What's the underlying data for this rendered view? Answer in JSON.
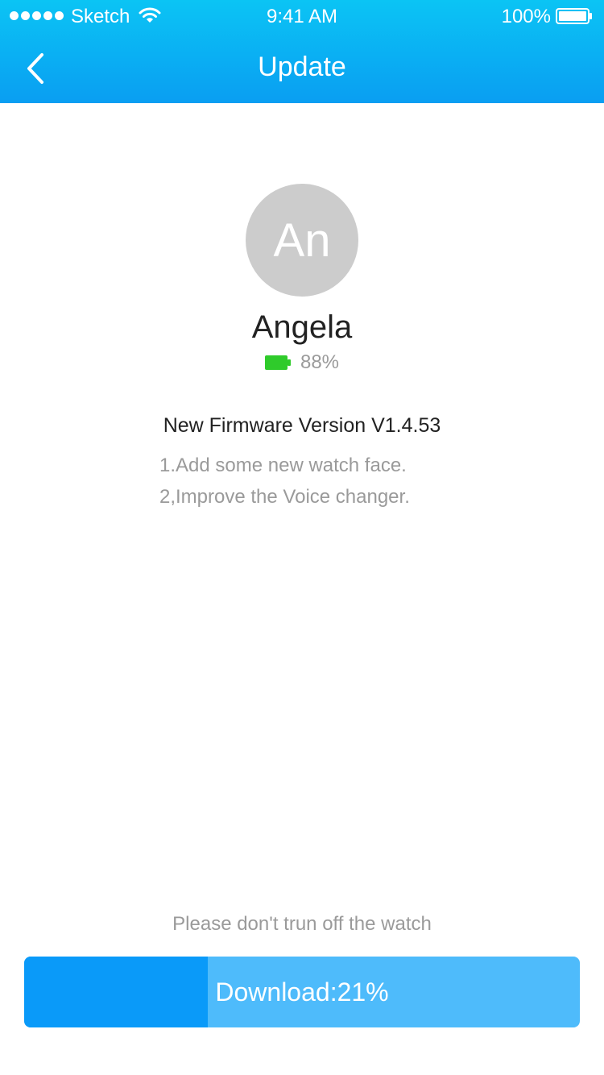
{
  "status_bar": {
    "carrier": "Sketch",
    "time": "9:41 AM",
    "battery": "100%"
  },
  "nav": {
    "title": "Update",
    "back_icon": "chevron-left-icon"
  },
  "device": {
    "avatar_initials": "An",
    "name": "Angela",
    "battery_text": "88%",
    "battery_level": 0.88,
    "battery_color": "#2fcb2b"
  },
  "firmware": {
    "title": "New Firmware Version V1.4.53",
    "changes": [
      "1.Add some new watch face.",
      "2,Improve the Voice changer."
    ]
  },
  "warning": "Please don't trun off the watch",
  "download": {
    "label": "Download:21%",
    "progress": 0.33,
    "fill_color": "#0a9af9",
    "track_color": "#4ebbfb"
  },
  "colors": {
    "header_top": "#0bc4f4",
    "header_bottom": "#0a9ef2"
  }
}
